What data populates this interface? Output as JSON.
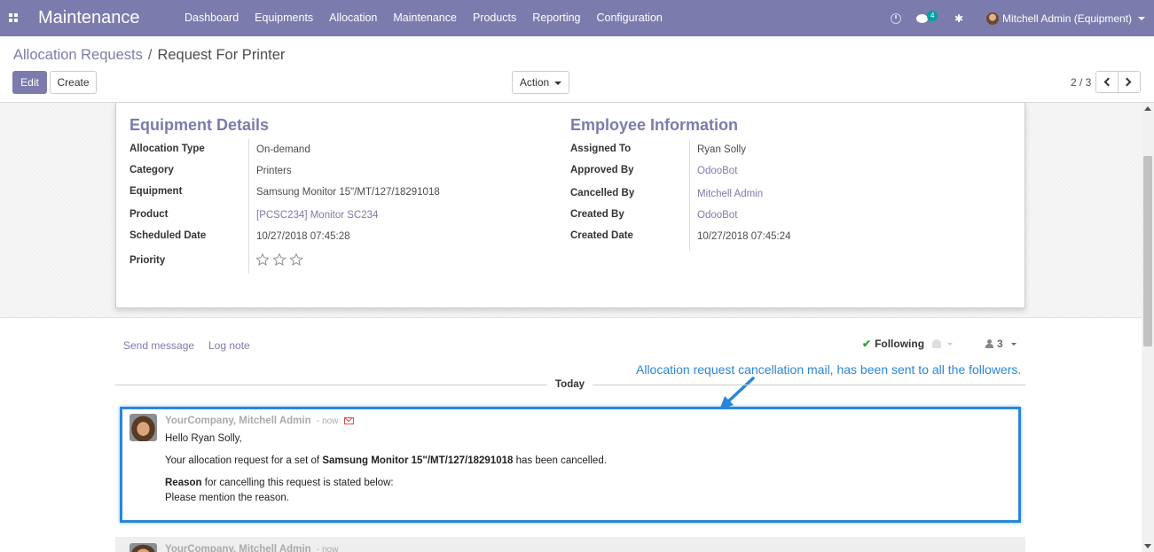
{
  "navbar": {
    "app_name": "Maintenance",
    "menu": [
      "Dashboard",
      "Equipments",
      "Allocation",
      "Maintenance",
      "Products",
      "Reporting",
      "Configuration"
    ],
    "chat_count": "4",
    "user": "Mitchell Admin (Equipment)",
    "background": "#7c7bad"
  },
  "breadcrumb": {
    "parent": "Allocation Requests",
    "separator": "/",
    "current": "Request For Printer"
  },
  "buttons": {
    "edit": "Edit",
    "create": "Create",
    "action": "Action"
  },
  "pager": {
    "value": "2 / 3"
  },
  "equipment_details": {
    "title": "Equipment Details",
    "fields": [
      {
        "label": "Allocation Type",
        "value": "On-demand"
      },
      {
        "label": "Category",
        "value": "Printers"
      },
      {
        "label": "Equipment",
        "value": "Samsung Monitor 15\"/MT/127/18291018"
      },
      {
        "label": "Product",
        "value": "[PCSC234] Monitor SC234"
      },
      {
        "label": "Scheduled Date",
        "value": "10/27/2018 07:45:28"
      },
      {
        "label": "Priority",
        "value": ""
      }
    ],
    "priority_stars": 0,
    "priority_max": 3
  },
  "employee_information": {
    "title": "Employee Information",
    "fields": [
      {
        "label": "Assigned To",
        "value": "Ryan Solly"
      },
      {
        "label": "Approved By",
        "value": "OdooBot"
      },
      {
        "label": "Cancelled By",
        "value": "Mitchell Admin"
      },
      {
        "label": "Created By",
        "value": "OdooBot"
      },
      {
        "label": "Created Date",
        "value": "10/27/2018 07:45:24"
      }
    ]
  },
  "chatter": {
    "send_message": "Send message",
    "log_note": "Log note",
    "following": "Following",
    "followers_count": "3",
    "today": "Today",
    "annotation": "Allocation request cancellation mail, has been sent to all the followers.",
    "message": {
      "author": "YourCompany, Mitchell Admin",
      "date": "- now",
      "greeting": "Hello Ryan Solly,",
      "line1_prefix": "Your allocation request for a set of",
      "line1_bold": "Samsung Monitor 15\"/MT/127/18291018",
      "line1_suffix": "has been cancelled.",
      "reason_bold": "Reason",
      "reason_rest": "for cancelling this request is stated below:",
      "reason_text": "Please mention the reason."
    },
    "next_message": {
      "author": "YourCompany, Mitchell Admin",
      "date": "- now"
    },
    "accent_color": "#2a86d9"
  }
}
